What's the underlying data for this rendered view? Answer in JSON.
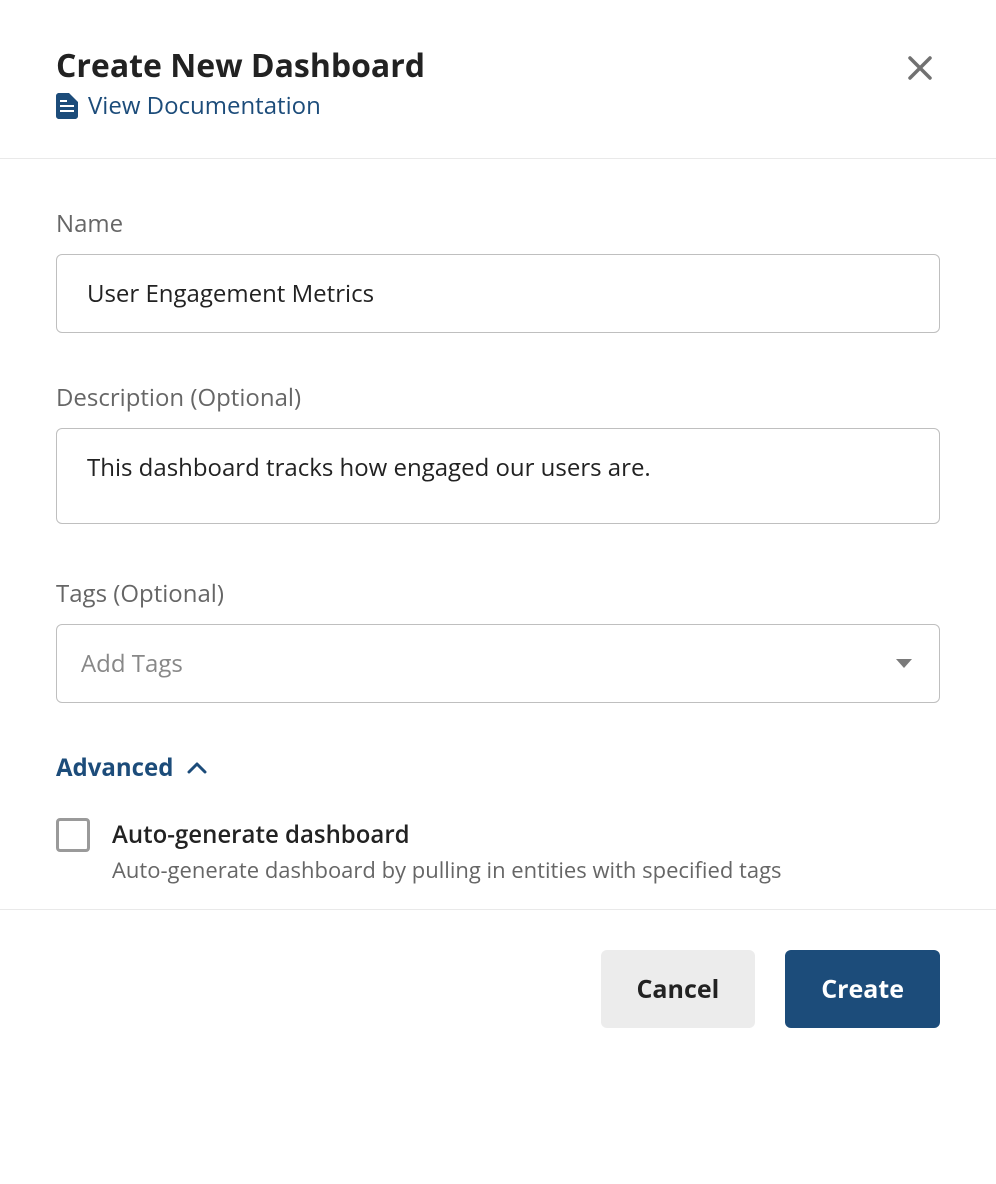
{
  "header": {
    "title": "Create New Dashboard",
    "doc_link_label": "View Documentation"
  },
  "form": {
    "name": {
      "label": "Name",
      "value": "User Engagement Metrics"
    },
    "description": {
      "label": "Description (Optional)",
      "value": "This dashboard tracks how engaged our users are."
    },
    "tags": {
      "label": "Tags (Optional)",
      "placeholder": "Add Tags"
    },
    "advanced": {
      "toggle_label": "Advanced",
      "expanded": true,
      "autogenerate": {
        "title": "Auto-generate dashboard",
        "desc": "Auto-generate dashboard by pulling in entities with specified tags",
        "checked": false
      }
    }
  },
  "footer": {
    "cancel_label": "Cancel",
    "create_label": "Create"
  }
}
